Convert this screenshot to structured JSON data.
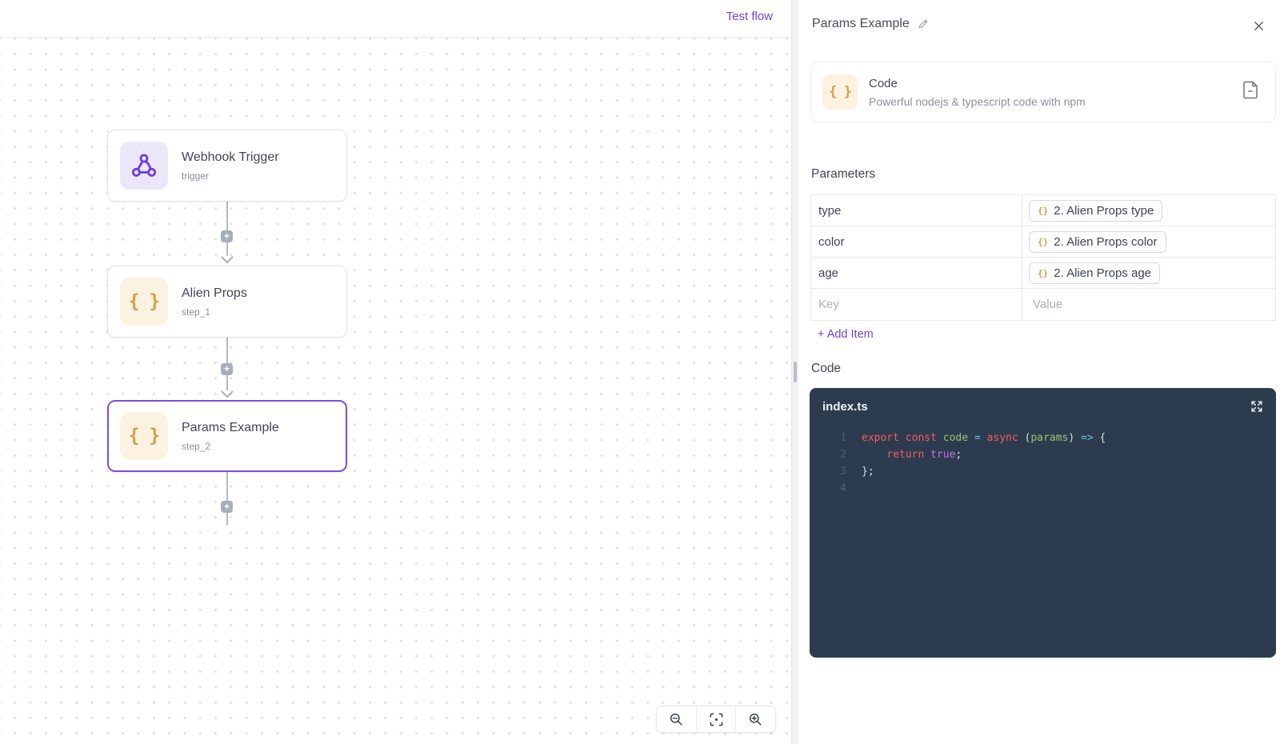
{
  "topbar": {
    "test_flow": "Test flow"
  },
  "canvas": {
    "nodes": [
      {
        "title": "Webhook Trigger",
        "subtitle": "trigger"
      },
      {
        "title": "Alien Props",
        "subtitle": "step_1"
      },
      {
        "title": "Params Example",
        "subtitle": "step_2"
      }
    ]
  },
  "icons": {
    "node_braces": "{ }",
    "chip_braces": "{}",
    "plus": "+"
  },
  "panel": {
    "title": "Params Example",
    "piece": {
      "title": "Code",
      "description": "Powerful nodejs & typescript code with npm"
    },
    "parameters": {
      "label": "Parameters",
      "rows": [
        {
          "key": "type",
          "chip": "2. Alien Props type"
        },
        {
          "key": "color",
          "chip": "2. Alien Props color"
        },
        {
          "key": "age",
          "chip": "2. Alien Props age"
        }
      ],
      "key_placeholder": "Key",
      "value_placeholder": "Value",
      "add_item": "+ Add Item"
    },
    "code": {
      "label": "Code",
      "filename": "index.ts",
      "lines": [
        {
          "num": "1",
          "tokens": [
            {
              "t": "export"
            },
            {
              "t": " "
            },
            {
              "t": "const"
            },
            {
              "t": " "
            },
            {
              "t": "code"
            },
            {
              "t": " "
            },
            {
              "t": "="
            },
            {
              "t": " "
            },
            {
              "t": "async"
            },
            {
              "t": " ("
            },
            {
              "t": "params"
            },
            {
              "t": ") "
            },
            {
              "t": "=>"
            },
            {
              "t": " {"
            }
          ]
        },
        {
          "num": "2",
          "tokens": [
            {
              "t": "    "
            },
            {
              "t": "return"
            },
            {
              "t": " "
            },
            {
              "t": "true"
            },
            {
              "t": ";"
            }
          ]
        },
        {
          "num": "3",
          "tokens": [
            {
              "t": "};"
            }
          ]
        },
        {
          "num": "4",
          "tokens": []
        }
      ]
    }
  },
  "colors": {
    "accent_purple": "#6e41e2",
    "selected_node_border": "#7a4fe0",
    "braces_orange": "#d2a045",
    "webhook_icon_bg": "#ece6fb",
    "code_icon_bg": "#fbf2e2",
    "editor_bg": "#2d3b4e",
    "code_keyword": "#ee5d63",
    "code_identifier": "#98c379",
    "code_operator": "#62c5da",
    "code_boolean": "#bc78e0",
    "code_plain": "#d8dee9"
  }
}
